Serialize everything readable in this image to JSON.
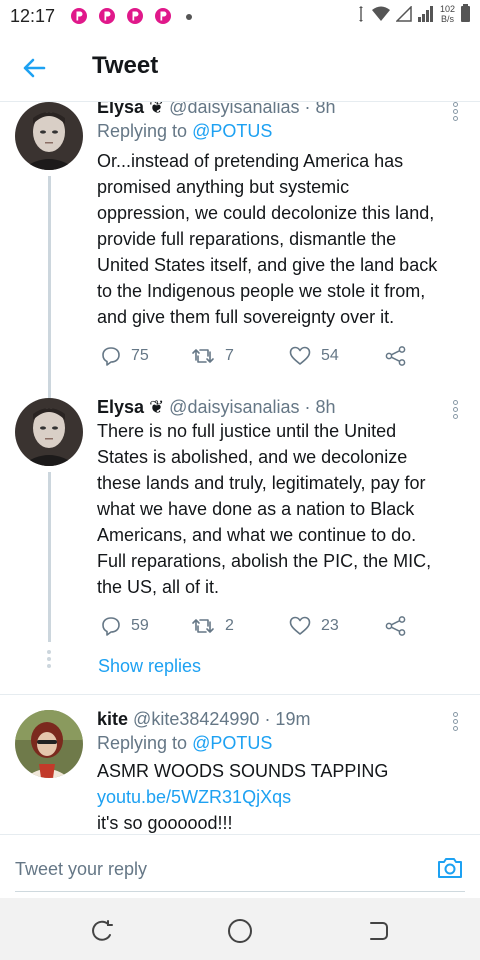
{
  "status": {
    "time": "12:17",
    "net_speed_value": "102",
    "net_speed_unit": "B/s"
  },
  "header": {
    "title": "Tweet",
    "back_icon": "arrow-left-icon"
  },
  "tweets": [
    {
      "name": "Elysa",
      "badge": "❦",
      "handle": "@daisyisanalias",
      "time": "· 8h",
      "reply_prefix": "Replying to ",
      "reply_to": "@POTUS",
      "lines": [
        "Or...instead of pretending America has",
        "promised anything but systemic",
        "oppression, we could decolonize this land,",
        "provide full reparations, dismantle the",
        "United States itself, and give the land back",
        "to the Indigenous people we stole it from,",
        "and give them full sovereignty over it."
      ],
      "replies": "75",
      "retweets": "7",
      "likes": "54"
    },
    {
      "name": "Elysa",
      "badge": "❦",
      "handle": "@daisyisanalias",
      "time": "· 8h",
      "lines": [
        "There is no full justice until the United",
        "States is abolished, and we decolonize",
        "these lands and truly, legitimately, pay for",
        "what we have done as a nation to Black",
        "Americans, and what we continue to do.",
        "Full reparations, abolish the PIC, the MIC,",
        "the US, all of it."
      ],
      "replies": "59",
      "retweets": "2",
      "likes": "23",
      "show_replies": "Show replies"
    },
    {
      "name": "kite",
      "handle": "@kite38424990",
      "time": "· 19m",
      "reply_prefix": "Replying to ",
      "reply_to": "@POTUS",
      "text": "ASMR WOODS SOUNDS TAPPING",
      "link": "youtu.be/5WZR31QjXqs",
      "text2": "it's so goooood!!!"
    }
  ],
  "reply_bar": {
    "placeholder": "Tweet your reply"
  },
  "colors": {
    "accent": "#1da1f2",
    "text": "#14171a",
    "muted": "#657786"
  }
}
